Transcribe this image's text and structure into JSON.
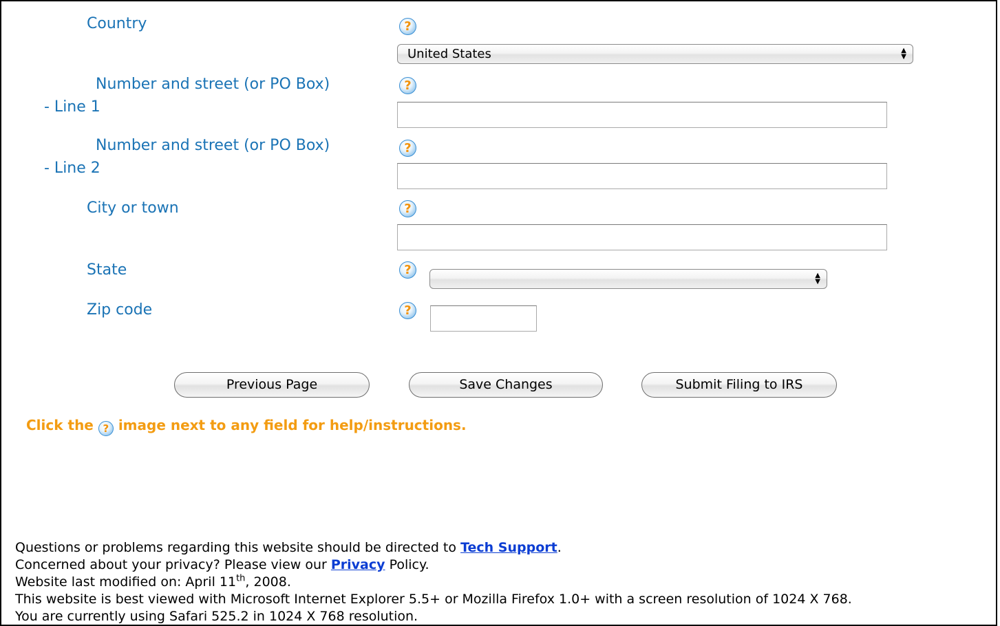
{
  "form": {
    "country_label": "Country",
    "country_value": "United States",
    "street1_label_a": "Number and street (or PO Box)",
    "street1_label_b": "- Line 1",
    "street2_label_a": "Number and street (or PO Box)",
    "street2_label_b": "- Line 2",
    "city_label": "City or town",
    "state_label": "State",
    "state_value": "",
    "zip_label": "Zip code",
    "help_glyph": "?",
    "help_icon": "help-question-icon"
  },
  "buttons": {
    "previous": "Previous Page",
    "save": "Save Changes",
    "submit": "Submit Filing to IRS"
  },
  "hint": {
    "before": "Click the",
    "after": "image next to any field for help/instructions."
  },
  "footer": {
    "line1_before": "Questions or problems regarding this website should be directed to ",
    "line1_link": "Tech Support",
    "line1_after": ".",
    "line2_before": "Concerned about your privacy? Please view our ",
    "line2_link": "Privacy",
    "line2_after": " Policy.",
    "line3_before": "Website last modified on: April 11",
    "line3_sup": "th",
    "line3_after": ", 2008.",
    "line4": "This website is best viewed with Microsoft Internet Explorer 5.5+ or Mozilla Firefox 1.0+ with a screen resolution of 1024 X 768.",
    "line5": "You are currently using Safari 525.2 in 1024 X 768 resolution."
  },
  "colors": {
    "label": "#1a73b5",
    "hint": "#f39c12",
    "link": "#0b3dd3"
  }
}
